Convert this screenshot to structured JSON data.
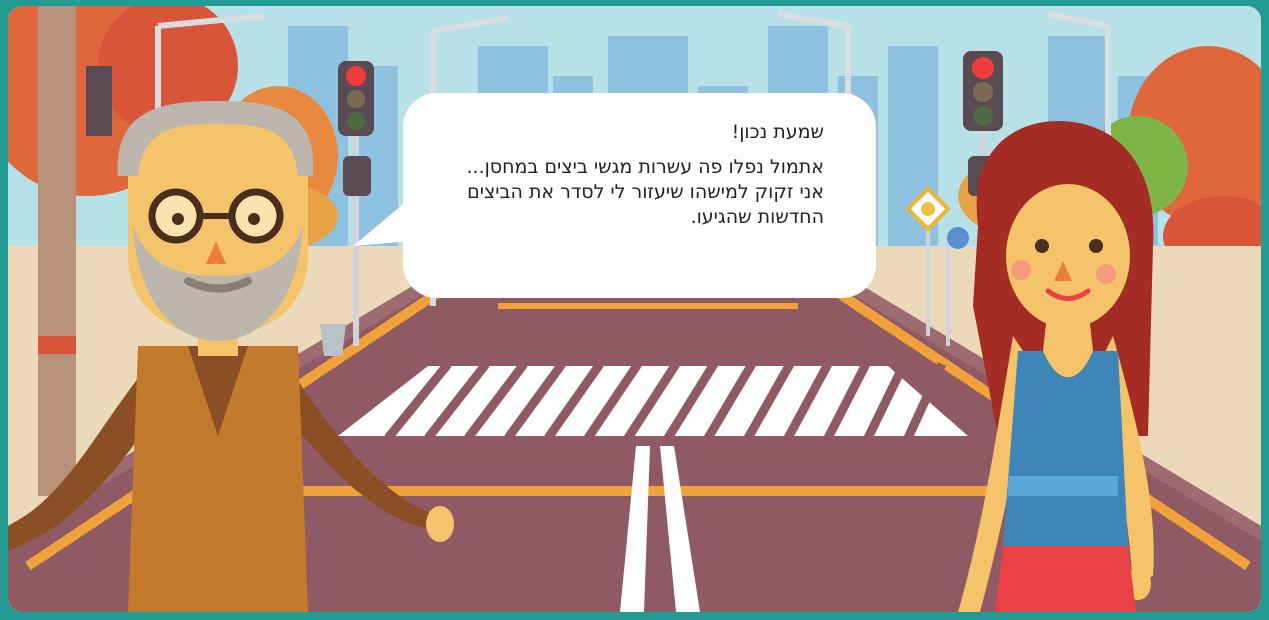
{
  "dialog": {
    "speaker_exclamation": "שמעת נכון!",
    "body": "אתמול נפלו פה עשרות מגשי ביצים במחסן... אני זקוק למישהו שיעזור לי לסדר את הביצים החדשות שהגיעו."
  },
  "scene": {
    "colors": {
      "sky": "#b6dfe6",
      "road": "#8f5a64",
      "crosswalk": "#ffffff",
      "road_line": "#f2a23a",
      "frame": "#229c93"
    },
    "characters": [
      "old-man",
      "young-woman"
    ],
    "traffic_light_state": "red"
  }
}
